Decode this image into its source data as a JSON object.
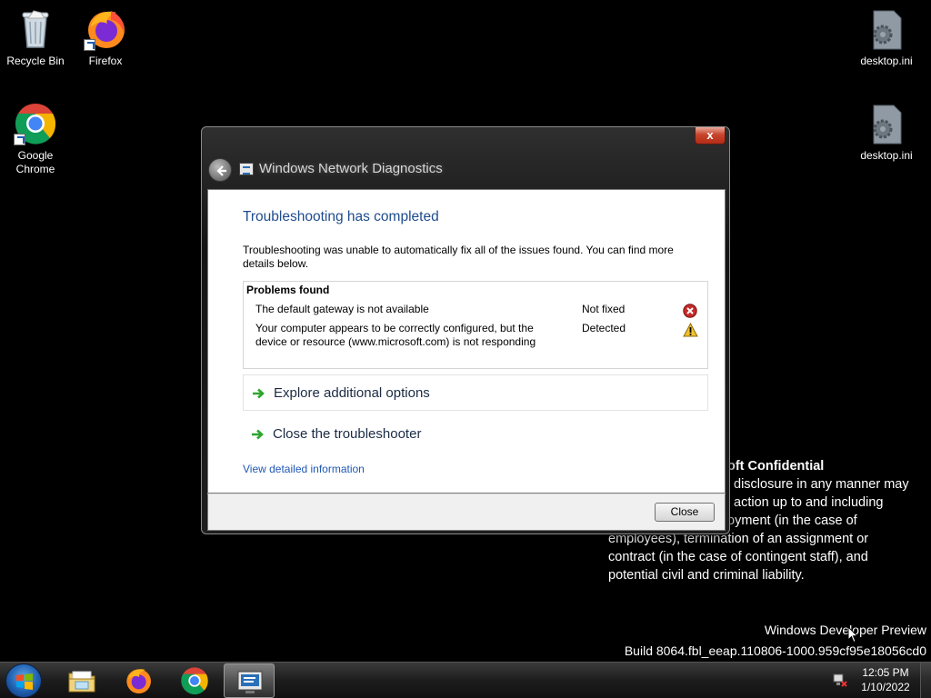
{
  "desktop": {
    "icons": [
      {
        "label": "Recycle Bin",
        "icon": "recycle-bin-icon"
      },
      {
        "label": "Firefox",
        "icon": "firefox-icon"
      },
      {
        "label": "Google Chrome",
        "icon": "chrome-icon"
      },
      {
        "label": "desktop.ini",
        "icon": "settings-file-icon"
      },
      {
        "label": "desktop.ini",
        "icon": "settings-file-icon"
      }
    ],
    "watermark": {
      "title": "oft Confidential",
      "line1": "disclosure in any manner may",
      "line2": "action up to and including",
      "line3": "oyment (in the case of",
      "line4": "employees), termination of an assignment or",
      "line5": "contract (in the case of contingent staff), and",
      "line6": "potential civil and criminal liability."
    },
    "build": {
      "line1": "Windows Developer Preview",
      "line2": "Build 8064.fbl_eeap.110806-1000.959cf95e18056cd0"
    }
  },
  "dialog": {
    "title": "Windows Network Diagnostics",
    "close_glyph": "x",
    "heading": "Troubleshooting has completed",
    "summary": "Troubleshooting was unable to automatically fix all of the issues found. You can find more details below.",
    "problems_header": "Problems found",
    "problems": [
      {
        "description": "The default gateway is not available",
        "status": "Not fixed",
        "status_icon": "error-icon"
      },
      {
        "description": "Your computer appears to be correctly configured, but the device or resource (www.microsoft.com) is not responding",
        "status": "Detected",
        "status_icon": "warning-icon"
      }
    ],
    "actions": [
      {
        "label": "Explore additional options"
      },
      {
        "label": "Close the troubleshooter"
      }
    ],
    "details_link": "View detailed information",
    "close_button": "Close"
  },
  "taskbar": {
    "pinned": [
      "explorer-icon",
      "firefox-icon",
      "chrome-icon",
      "network-diagnostics-icon"
    ],
    "clock_time": "12:05 PM",
    "clock_date": "1/10/2022"
  },
  "colors": {
    "heading": "#1e4c8e",
    "link": "#1f58b5",
    "error": "#c62a2a",
    "warning": "#f2c12e",
    "arrow": "#2fa62f"
  }
}
